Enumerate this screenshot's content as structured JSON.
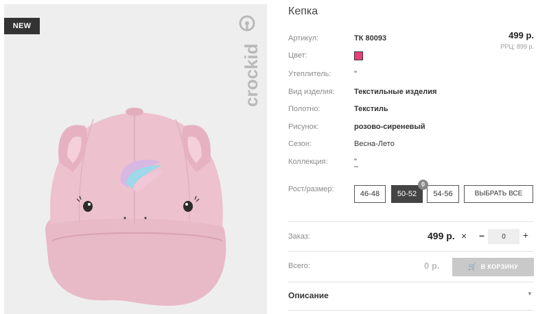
{
  "product": {
    "title": "Кепка",
    "badge": "NEW",
    "brand": "crockid",
    "price": "499 р.",
    "rrp": "РРЦ: 899 р."
  },
  "attributes": {
    "article": {
      "label": "Артикул:",
      "value": "ТК 80093"
    },
    "color": {
      "label": "Цвет:",
      "swatch": "#e8407a"
    },
    "insulation": {
      "label": "Утеплитель:",
      "value": "\""
    },
    "type": {
      "label": "Вид изделия:",
      "value": "Текстильные изделия"
    },
    "fabric": {
      "label": "Полотно:",
      "value": "Текстиль"
    },
    "pattern": {
      "label": "Рисунок:",
      "value": "розово-сиреневый"
    },
    "season": {
      "label": "Сезон:",
      "value": "Весна-Лето"
    },
    "collection": {
      "label": "Коллекция:",
      "value": "\"",
      "value2": "–"
    }
  },
  "sizes": {
    "label": "Рост/размер:",
    "options": [
      "46-48",
      "50-52",
      "54-56"
    ],
    "active": "50-52",
    "count": "0",
    "select_all": "ВЫБРАТЬ ВСЕ"
  },
  "order": {
    "label": "Заказ:",
    "price": "499 р.",
    "times": "×",
    "minus": "–",
    "qty": "0",
    "plus": "+"
  },
  "total": {
    "label": "Всего:",
    "price": "0 р.",
    "cart_button": "В КОРЗИНУ"
  },
  "description": {
    "title": "Описание"
  }
}
